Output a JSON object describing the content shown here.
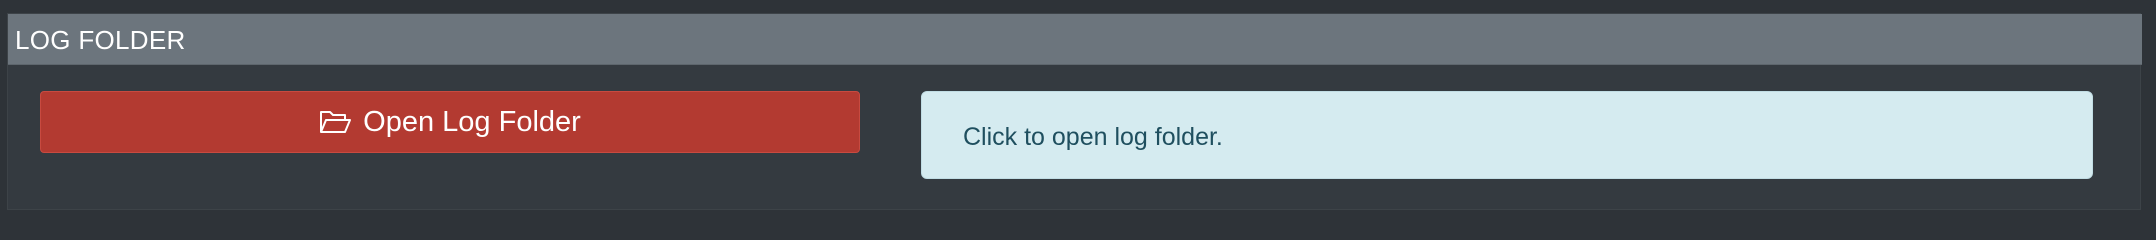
{
  "section": {
    "title": "LOG FOLDER"
  },
  "open_button": {
    "label": "Open Log Folder",
    "icon": "folder-open-icon"
  },
  "info": {
    "text": "Click to open log folder."
  },
  "colors": {
    "header_bg": "#6c757d",
    "panel_bg": "#343a40",
    "button_bg": "#b33a31",
    "info_bg": "#d5ebf0",
    "info_text": "#1f4f5f"
  }
}
